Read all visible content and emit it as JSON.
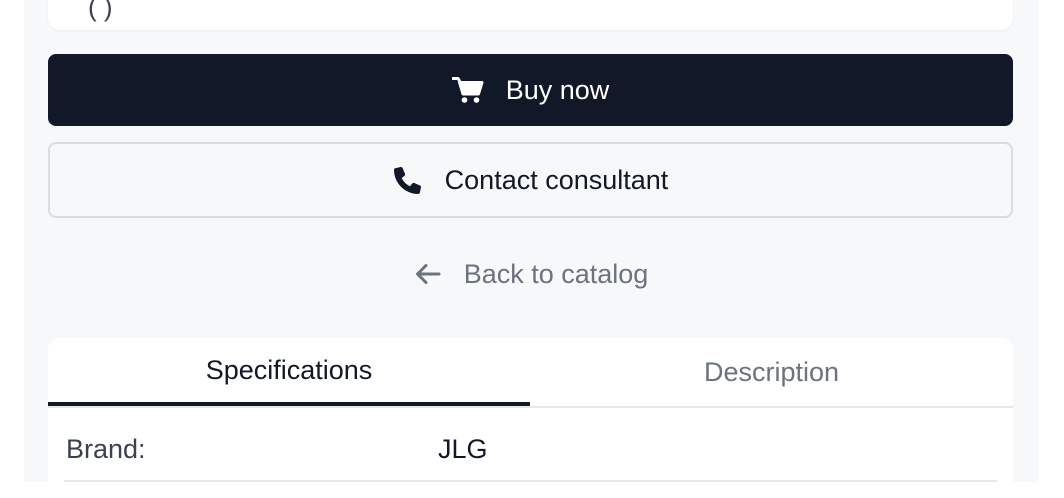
{
  "top_card": {
    "text": "(   )"
  },
  "actions": {
    "buy_label": "Buy now",
    "contact_label": "Contact consultant",
    "back_label": "Back to catalog"
  },
  "tabs": [
    {
      "label": "Specifications",
      "active": true
    },
    {
      "label": "Description",
      "active": false
    }
  ],
  "specs": [
    {
      "label": "Brand:",
      "value": "JLG"
    }
  ],
  "colors": {
    "primary": "#111827",
    "muted_text": "#6b7280",
    "page_bg": "#f7f8fa",
    "border": "#d9dce1"
  },
  "icons": {
    "buy": "cart-icon",
    "contact": "phone-icon",
    "back": "arrow-left-icon"
  }
}
